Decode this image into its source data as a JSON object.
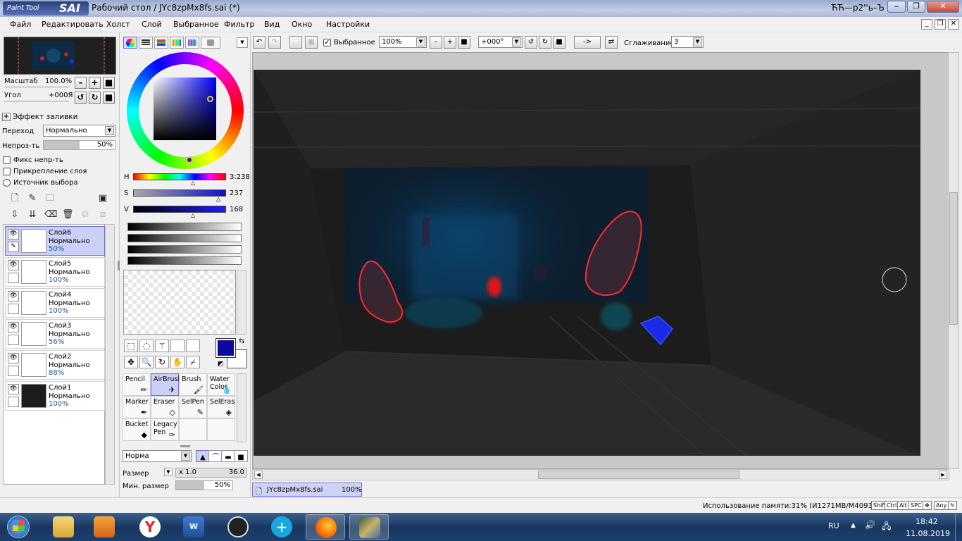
{
  "window": {
    "logo_small": "Paint Tool",
    "logo_big": "SAI",
    "title": "Рабочий стол / JYc8zpMx8fs.sai (*)",
    "title_right": "ЋЋ—р2''ь–Ъ"
  },
  "menu": [
    "Файл",
    "Редактировать",
    "Холст",
    "Слой",
    "Выбранное",
    "Фильтр",
    "Вид",
    "Окно",
    "Настройки"
  ],
  "navigator": {
    "zoom_label": "Масштаб",
    "zoom_value": "100.0%",
    "angle_label": "Угол",
    "angle_value": "+000Я"
  },
  "layer_props": {
    "fill_effect": "Эффект заливки",
    "blend_label": "Переход",
    "blend_value": "Нормально",
    "opacity_label": "Непроз-ть",
    "opacity_value": "50%",
    "opacity_fraction": 0.5,
    "lock_opacity": "Фикс непр-ть",
    "clip_layer": "Прикрепление слоя",
    "selection_source": "Источник выбора"
  },
  "layers": [
    {
      "name": "Слой6",
      "mode": "Нормально",
      "opacity": "50%",
      "selected": true
    },
    {
      "name": "Слой5",
      "mode": "Нормально",
      "opacity": "100%",
      "selected": false
    },
    {
      "name": "Слой4",
      "mode": "Нормально",
      "opacity": "100%",
      "selected": false
    },
    {
      "name": "Слой3",
      "mode": "Нормально",
      "opacity": "56%",
      "selected": false
    },
    {
      "name": "Слой2",
      "mode": "Нормально",
      "opacity": "88%",
      "selected": false
    },
    {
      "name": "Слой1",
      "mode": "Нормально",
      "opacity": "100%",
      "selected": false
    }
  ],
  "color": {
    "h_label": "H",
    "h_value": "3:238",
    "s_label": "S",
    "s_value": "237",
    "v_label": "V",
    "v_value": "168",
    "primary": "#0b0a9c",
    "secondary": "#ffffff",
    "accent": "#6c74d8"
  },
  "tools": [
    {
      "name": "Pencil",
      "icon": "pencil-icon",
      "selected": false
    },
    {
      "name": "AirBrush",
      "icon": "airbrush-icon",
      "selected": true
    },
    {
      "name": "Brush",
      "icon": "brush-icon",
      "selected": false
    },
    {
      "name": "Water Color",
      "icon": "watercolor-icon",
      "selected": false
    },
    {
      "name": "Marker",
      "icon": "marker-icon",
      "selected": false
    },
    {
      "name": "Eraser",
      "icon": "eraser-icon",
      "selected": false
    },
    {
      "name": "SelPen",
      "icon": "selpen-icon",
      "selected": false
    },
    {
      "name": "SelEras",
      "icon": "seleras-icon",
      "selected": false
    },
    {
      "name": "Bucket",
      "icon": "bucket-icon",
      "selected": false
    },
    {
      "name": "Legacy Pen",
      "icon": "legacypen-icon",
      "selected": false
    }
  ],
  "brush": {
    "mode": "Норма",
    "size_label": "Размер",
    "size_multiplier": "x 1.0",
    "size_value": "36.0",
    "min_size_label": "Мин. размер",
    "min_size_value": "50%",
    "min_size_fraction": 0.5
  },
  "toolbar": {
    "selection_label": "Выбранное",
    "zoom": "100%",
    "angle": "+000°",
    "arrow": "->",
    "smoothing_label": "Сглаживание",
    "smoothing_value": "3"
  },
  "document": {
    "tab_name": "JYc8zpMx8fs.sai",
    "tab_zoom": "100%"
  },
  "status": {
    "memory": "Использование памяти:31% (И1271MB/M4093MB)",
    "keys": [
      "Shift",
      "Ctrl",
      "Alt",
      "SPC",
      "Any"
    ]
  },
  "taskbar": {
    "lang": "RU",
    "time": "18:42",
    "date": "11.08.2019"
  }
}
